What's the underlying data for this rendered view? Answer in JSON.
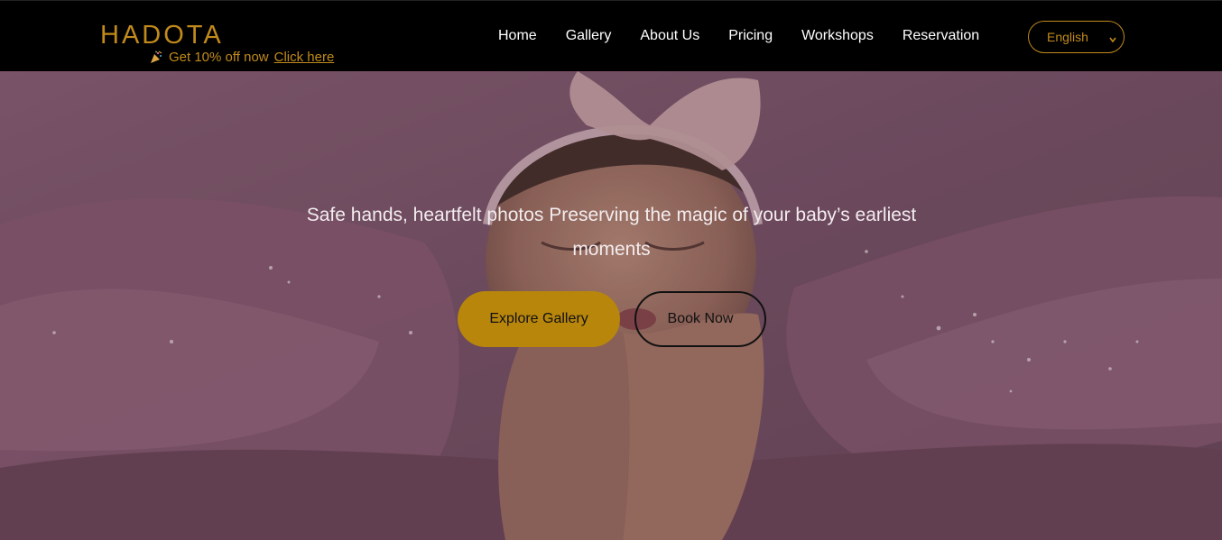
{
  "header": {
    "logo": "HADOTA",
    "promo_text": "Get 10% off now",
    "promo_link": "Click here",
    "promo_icon": "party-popper-icon"
  },
  "nav": {
    "items": [
      {
        "label": "Home"
      },
      {
        "label": "Gallery"
      },
      {
        "label": "About Us"
      },
      {
        "label": "Pricing"
      },
      {
        "label": "Workshops"
      },
      {
        "label": "Reservation"
      }
    ]
  },
  "language": {
    "selected": "English"
  },
  "hero": {
    "tagline": "Safe hands, heartfelt photos Preserving the magic of your baby’s earliest moments",
    "explore_label": "Explore Gallery",
    "book_label": "Book Now"
  },
  "colors": {
    "accent": "#c18a1b",
    "button": "#b8860b",
    "header_bg": "#000000"
  }
}
